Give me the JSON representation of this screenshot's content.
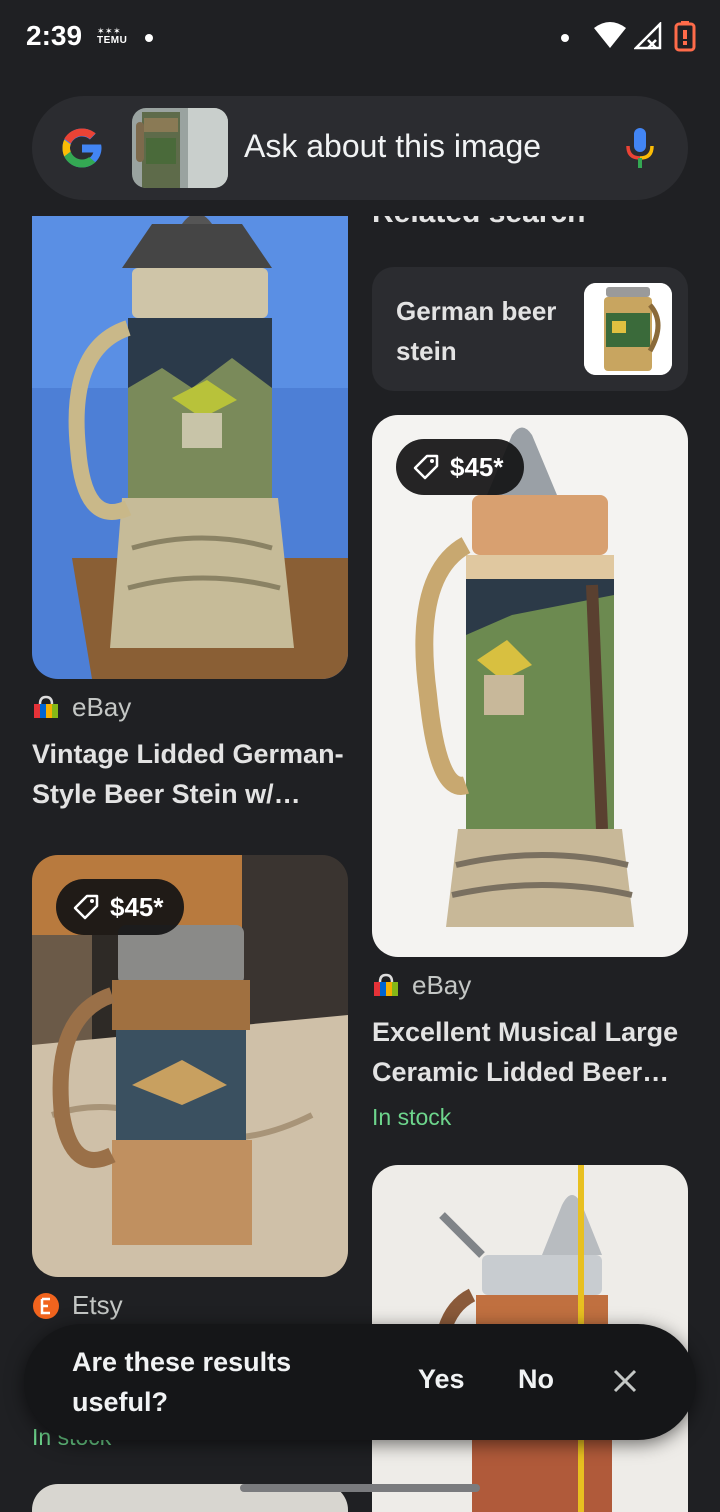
{
  "status_bar": {
    "time": "2:39",
    "temu_label": "TEMU",
    "icons": [
      "notification-dot-icon",
      "wifi-icon",
      "signal-icon",
      "battery-low-icon"
    ]
  },
  "search": {
    "placeholder": "Ask about this image",
    "logo": "google-g-logo",
    "mic_icon": "mic-icon"
  },
  "results": {
    "left": [
      {
        "source": "eBay",
        "title": "Vintage Lidded German-Style Beer Stein w/…",
        "price": "",
        "stock": ""
      },
      {
        "source": "Etsy",
        "title": "",
        "price": "$45*",
        "stock": "In stock"
      }
    ],
    "right": [
      {
        "source": "eBay",
        "title": "Excellent Musical Large Ceramic Lidded Beer…",
        "price": "$45*",
        "stock": "In stock"
      }
    ]
  },
  "related": {
    "heading": "Related search",
    "label": "German beer stein"
  },
  "feedback": {
    "question": "Are these results useful?",
    "yes": "Yes",
    "no": "No",
    "close_icon": "close-icon"
  },
  "colors": {
    "background": "#1f2023",
    "surface": "#2b2c30",
    "stock_green": "#6dd58c",
    "text": "#e3e3e3"
  }
}
